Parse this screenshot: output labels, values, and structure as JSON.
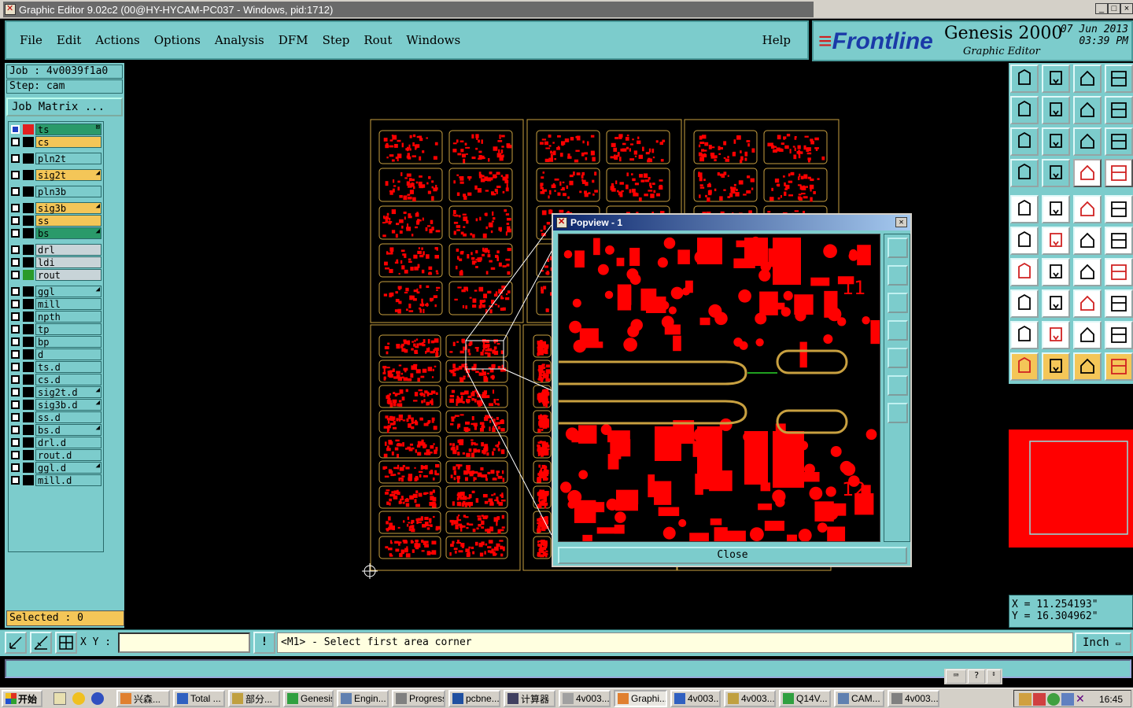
{
  "window": {
    "title": "Graphic Editor 9.02c2 (00@HY-HYCAM-PC037 - Windows, pid:1712)",
    "min_label": "_",
    "max_label": "□",
    "close_label": "×"
  },
  "menu": {
    "items": [
      "File",
      "Edit",
      "Actions",
      "Options",
      "Analysis",
      "DFM",
      "Step",
      "Rout",
      "Windows"
    ],
    "help": "Help"
  },
  "brand": {
    "logo": "Frontline",
    "product": "Genesis 2000",
    "subtitle": "Graphic Editor",
    "date": "07 Jun 2013",
    "time": "03:39 PM"
  },
  "job": {
    "job_line": "Job : 4v0039f1a0",
    "step_line": "Step: cam",
    "matrix_button": "Job Matrix ..."
  },
  "layers": [
    {
      "name": "ts",
      "color": "#2a9a6a",
      "swatch": "#e02020",
      "mark": "⊠"
    },
    {
      "name": "cs",
      "color": "#f4c658",
      "swatch": "#000000",
      "mark": ""
    },
    {
      "name": "pln2t",
      "color": "#7ccccc",
      "swatch": "#000000",
      "mark": ""
    },
    {
      "name": "sig2t",
      "color": "#f4c658",
      "swatch": "#000000",
      "mark": "◢"
    },
    {
      "name": "pln3b",
      "color": "#7ccccc",
      "swatch": "#000000",
      "mark": ""
    },
    {
      "name": "sig3b",
      "color": "#f4c658",
      "swatch": "#000000",
      "mark": "◢"
    },
    {
      "name": "ss",
      "color": "#f4c658",
      "swatch": "#000000",
      "mark": ""
    },
    {
      "name": "bs",
      "color": "#2a9a6a",
      "swatch": "#000000",
      "mark": "◢"
    },
    {
      "name": "drl",
      "color": "#c8d4d8",
      "swatch": "#000000",
      "mark": ""
    },
    {
      "name": "ldi",
      "color": "#c8d4d8",
      "swatch": "#000000",
      "mark": ""
    },
    {
      "name": "rout",
      "color": "#c8d4d8",
      "swatch": "#2a9a2a",
      "mark": ""
    },
    {
      "name": "ggl",
      "color": "#7ccccc",
      "swatch": "#000000",
      "mark": "◢"
    },
    {
      "name": "mill",
      "color": "#7ccccc",
      "swatch": "#000000",
      "mark": ""
    },
    {
      "name": "npth",
      "color": "#7ccccc",
      "swatch": "#000000",
      "mark": ""
    },
    {
      "name": "tp",
      "color": "#7ccccc",
      "swatch": "#000000",
      "mark": ""
    },
    {
      "name": "bp",
      "color": "#7ccccc",
      "swatch": "#000000",
      "mark": ""
    },
    {
      "name": "d",
      "color": "#7ccccc",
      "swatch": "#000000",
      "mark": ""
    },
    {
      "name": "ts.d",
      "color": "#7ccccc",
      "swatch": "#000000",
      "mark": ""
    },
    {
      "name": "cs.d",
      "color": "#7ccccc",
      "swatch": "#000000",
      "mark": ""
    },
    {
      "name": "sig2t.d",
      "color": "#7ccccc",
      "swatch": "#000000",
      "mark": "◢"
    },
    {
      "name": "sig3b.d",
      "color": "#7ccccc",
      "swatch": "#000000",
      "mark": "◢"
    },
    {
      "name": "ss.d",
      "color": "#7ccccc",
      "swatch": "#000000",
      "mark": ""
    },
    {
      "name": "bs.d",
      "color": "#7ccccc",
      "swatch": "#000000",
      "mark": "◢"
    },
    {
      "name": "drl.d",
      "color": "#7ccccc",
      "swatch": "#000000",
      "mark": ""
    },
    {
      "name": "rout.d",
      "color": "#7ccccc",
      "swatch": "#000000",
      "mark": ""
    },
    {
      "name": "ggl.d",
      "color": "#7ccccc",
      "swatch": "#000000",
      "mark": "◢"
    },
    {
      "name": "mill.d",
      "color": "#7ccccc",
      "swatch": "#000000",
      "mark": ""
    }
  ],
  "selected": "Selected : 0",
  "popview": {
    "title": "Popview - 1",
    "close_button": "Close",
    "label_11": "11",
    "label_12": "12"
  },
  "coords": {
    "x": "X = 11.254193\"",
    "y": "Y = 16.304962\""
  },
  "cmdbar": {
    "xy_label": "X Y :",
    "xy_value": "",
    "bang": "!",
    "message": "<M1> - Select first area corner",
    "unit": "Inch"
  },
  "taskbar": {
    "start": "开始",
    "items": [
      "兴森...",
      "Total ...",
      "部分...",
      "Genesis",
      "Engin...",
      "Progress",
      "pcbne...",
      "计算器",
      "4v003...",
      "Graphi...",
      "4v003...",
      "4v003...",
      "Q14V...",
      "CAM...",
      "4v003..."
    ],
    "active": "Graphi...",
    "clock": "16:45"
  },
  "colors": {
    "panel": "#7ccccc",
    "copper": "#ff0000",
    "outline": "#c8a040",
    "highlight": "#f4c658"
  },
  "icons": {
    "right_toolbar": [
      "open-job-icon",
      "save-icon",
      "home-icon",
      "window-icon",
      "zoom-left-icon",
      "zoom-right-icon",
      "undo-zoom-icon",
      "redo-icon",
      "fit-icon",
      "center-icon",
      "ratio-icon",
      "help-icon",
      "measure-icon",
      "probe-icon",
      "layers-icon",
      "snap-icon"
    ]
  }
}
